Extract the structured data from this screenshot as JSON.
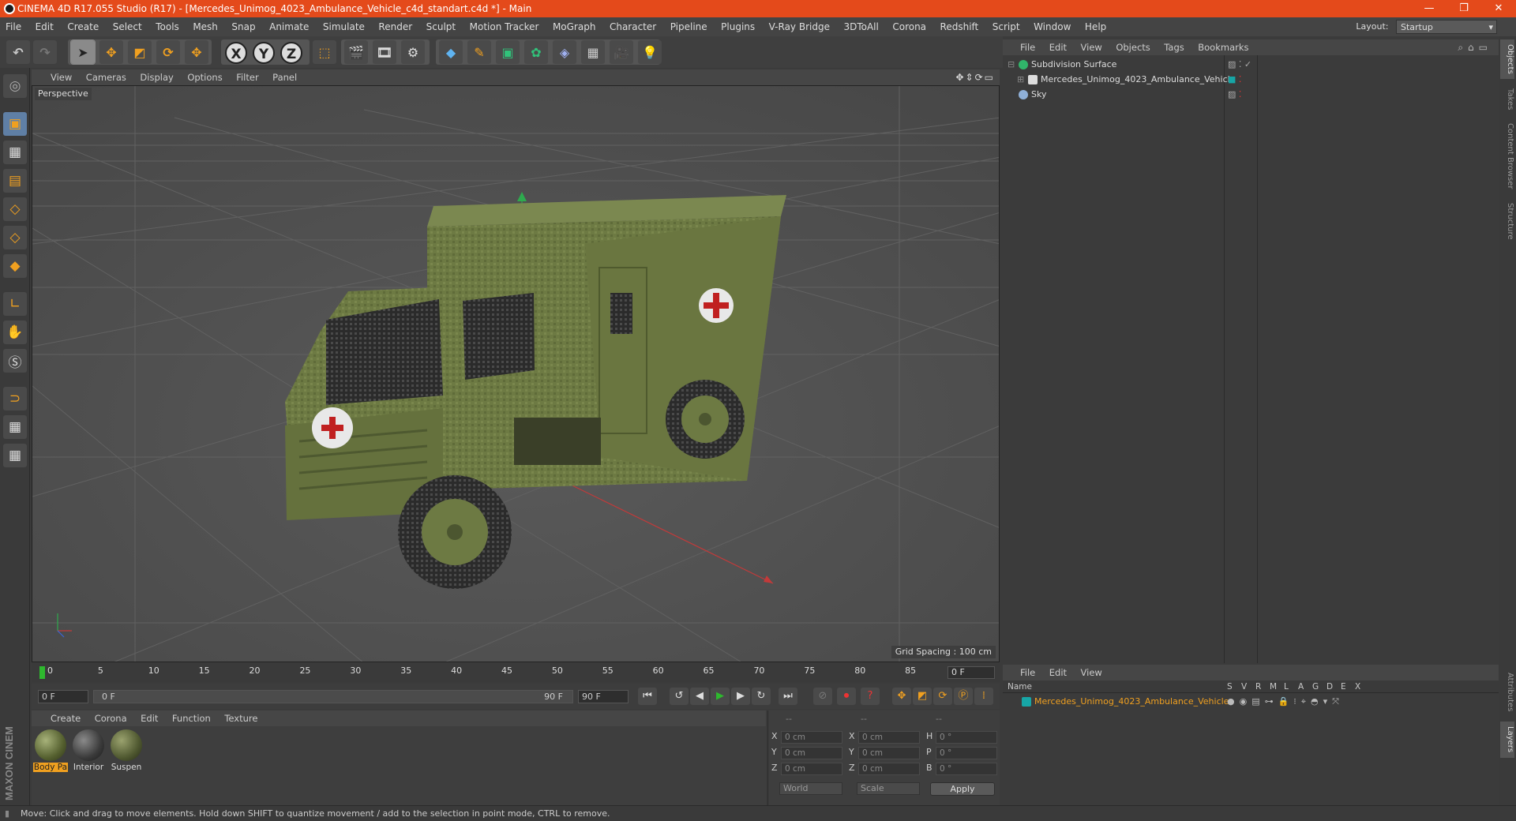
{
  "window": {
    "title": "CINEMA 4D R17.055 Studio (R17) - [Mercedes_Unimog_4023_Ambulance_Vehicle_c4d_standart.c4d *] - Main",
    "controls": [
      "minimize-icon",
      "restore-icon",
      "close-icon"
    ]
  },
  "menu": [
    "File",
    "Edit",
    "Create",
    "Select",
    "Tools",
    "Mesh",
    "Snap",
    "Animate",
    "Simulate",
    "Render",
    "Sculpt",
    "Motion Tracker",
    "MoGraph",
    "Character",
    "Pipeline",
    "Plugins",
    "V-Ray Bridge",
    "3DToAll",
    "Corona",
    "Redshift",
    "Script",
    "Window",
    "Help"
  ],
  "layout": {
    "label": "Layout:",
    "value": "Startup"
  },
  "toolbar": {
    "axis_x": "X",
    "axis_y": "Y",
    "axis_z": "Z",
    "icons": [
      "undo-icon",
      "redo-icon",
      "live-select-icon",
      "move-icon",
      "scale-icon",
      "rotate-icon",
      "recent-tool-icon",
      "axis-x-icon",
      "axis-y-icon",
      "axis-z-icon",
      "coordinate-system-icon",
      "render-view-icon",
      "render-picture-viewer-icon",
      "edit-render-settings-icon",
      "cube-icon",
      "pen-spline-icon",
      "subdivision-surface-icon",
      "array-icon",
      "deformer-icon",
      "floor-icon",
      "camera-icon",
      "light-icon"
    ]
  },
  "viewport": {
    "menu": [
      "View",
      "Cameras",
      "Display",
      "Options",
      "Filter",
      "Panel"
    ],
    "camera_label": "Perspective",
    "grid_spacing": "Grid Spacing : 100 cm"
  },
  "timeline": {
    "ticks": [
      "0",
      "5",
      "10",
      "15",
      "20",
      "25",
      "30",
      "35",
      "40",
      "45",
      "50",
      "55",
      "60",
      "65",
      "70",
      "75",
      "80",
      "85",
      "90"
    ],
    "current_frame": "0 F",
    "start_field": "0 F",
    "range_start": "0 F",
    "range_end": "90 F",
    "end_field": "90 F"
  },
  "materials": {
    "menu": [
      "Create",
      "Corona",
      "Edit",
      "Function",
      "Texture"
    ],
    "items": [
      {
        "label": "Body Pa",
        "selected": true
      },
      {
        "label": "Interior",
        "selected": false
      },
      {
        "label": "Suspen",
        "selected": false
      }
    ]
  },
  "coordinates": {
    "header": [
      "--",
      "--",
      "--"
    ],
    "rows": [
      {
        "a": "X",
        "av": "0 cm",
        "b": "X",
        "bv": "0 cm",
        "c": "H",
        "cv": "0 °"
      },
      {
        "a": "Y",
        "av": "0 cm",
        "b": "Y",
        "bv": "0 cm",
        "c": "P",
        "cv": "0 °"
      },
      {
        "a": "Z",
        "av": "0 cm",
        "b": "Z",
        "bv": "0 cm",
        "c": "B",
        "cv": "0 °"
      }
    ],
    "space": "World",
    "mode": "Scale",
    "apply": "Apply"
  },
  "objects": {
    "menu": [
      "File",
      "Edit",
      "View",
      "Objects",
      "Tags",
      "Bookmarks"
    ],
    "rows": [
      {
        "name": "Subdivision Surface",
        "icon_color": "#31b56a"
      },
      {
        "name": "Mercedes_Unimog_4023_Ambulance_Vehicle",
        "icon_color": "#dddddd"
      },
      {
        "name": "Sky",
        "icon_color": "#8fb0d8"
      }
    ]
  },
  "layers": {
    "menu": [
      "File",
      "Edit",
      "View"
    ],
    "columns": [
      "Name",
      "S",
      "V",
      "R",
      "M",
      "L",
      "A",
      "G",
      "D",
      "E",
      "X"
    ],
    "rows": [
      {
        "name": "Mercedes_Unimog_4023_Ambulance_Vehicle",
        "color": "#17a6a6"
      }
    ]
  },
  "right_tabs": [
    "Objects",
    "Takes",
    "Content Browser",
    "Structure",
    "Attributes",
    "Layers"
  ],
  "status": "Move: Click and drag to move elements. Hold down SHIFT to quantize movement / add to the selection in point mode, CTRL to remove.",
  "brand": "MAXON CINEMA 4D",
  "colors": {
    "titlebar": "#e44a1b",
    "accent": "#f0a020",
    "truck": "#6d7a43"
  }
}
